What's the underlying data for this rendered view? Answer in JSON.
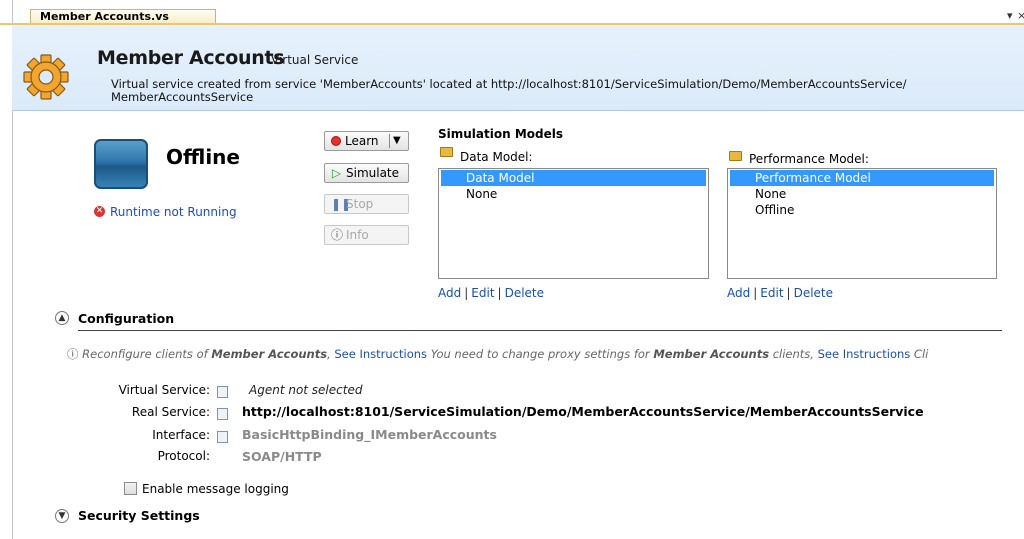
{
  "tab": {
    "title": "Member Accounts.vs",
    "pin_glyph": "▾",
    "close_glyph": "×"
  },
  "header": {
    "title": "Member Accounts",
    "subtitle": "Virtual Service",
    "description_line1": "Virtual service created from service 'MemberAccounts' located at http://localhost:8101/ServiceSimulation/Demo/MemberAccountsService/",
    "description_line2": "MemberAccountsService",
    "icon": "gear-icon"
  },
  "status": {
    "state": "Offline",
    "runtime_message": "Runtime not Running",
    "runtime_icon": "error-icon"
  },
  "buttons": {
    "learn": "Learn",
    "simulate": "Simulate",
    "stop": "Stop",
    "info": "Info"
  },
  "simulation_models": {
    "title": "Simulation Models",
    "data_model": {
      "label": "Data Model:",
      "items": [
        "Data Model",
        "None"
      ],
      "selected": "Data Model"
    },
    "performance_model": {
      "label": "Performance Model:",
      "items": [
        "Performance Model",
        "None",
        "Offline"
      ],
      "selected": "Performance Model"
    },
    "links": {
      "add": "Add",
      "edit": "Edit",
      "delete": "Delete",
      "separator": "|"
    }
  },
  "configuration": {
    "title": "Configuration",
    "info": {
      "part1": "Reconfigure clients of",
      "service_name": "Member Accounts",
      "part2": ",",
      "link1": "See Instructions",
      "part3": "You need to change proxy settings for",
      "part4": "clients,",
      "link2": "See Instructions",
      "part5": "Cli"
    },
    "virtual_service": {
      "label": "Virtual Service:",
      "value": "Agent not selected"
    },
    "real_service": {
      "label": "Real Service:",
      "value": "http://localhost:8101/ServiceSimulation/Demo/MemberAccountsService/MemberAccountsService"
    },
    "interface": {
      "label": "Interface:",
      "value": "BasicHttpBinding_IMemberAccounts"
    },
    "protocol": {
      "label": "Protocol:",
      "value": "SOAP/HTTP"
    },
    "message_logging": {
      "label": "Enable message logging",
      "checked": false
    }
  },
  "security": {
    "title": "Security Settings"
  },
  "colors": {
    "header_bg": "#dbeaf9",
    "tab_accent": "#eec76a",
    "link": "#1a4fb0",
    "selection": "#3399ff"
  }
}
